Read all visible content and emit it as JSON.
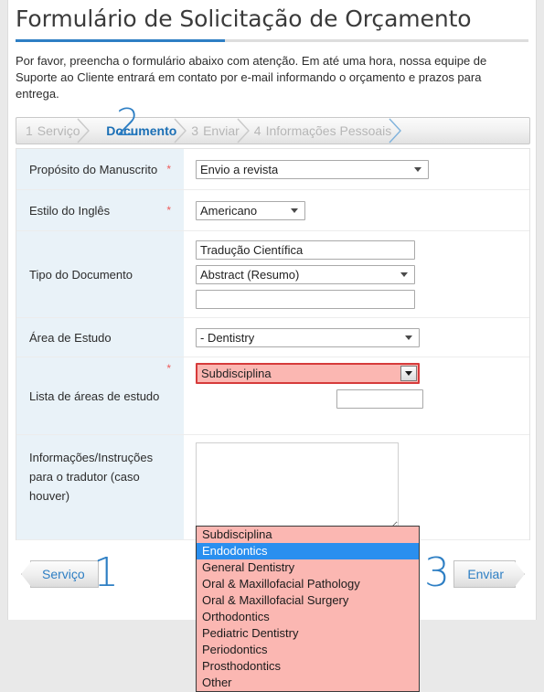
{
  "header": {
    "title": "Formulário de Solicitação de Orçamento",
    "intro": "Por favor, preencha o formulário abaixo com atenção. Em até uma hora, nossa equipe de Suporte ao Cliente entrará em contato por e-mail informando o orçamento e prazos para entrega."
  },
  "accent_color": "#2e7fc4",
  "steps": [
    {
      "num": "1",
      "label": "Serviço",
      "active": false
    },
    {
      "num": "2",
      "label": "Documento",
      "active": true
    },
    {
      "num": "3",
      "label": "Enviar",
      "active": false
    },
    {
      "num": "4",
      "label": "Informações Pessoais",
      "active": false
    }
  ],
  "big_step_number": "2",
  "form": {
    "rows": [
      {
        "label": "Propósito do Manuscrito",
        "required": "*",
        "control": {
          "type": "select",
          "value": "Envio a revista"
        }
      },
      {
        "label": "Estilo do Inglês",
        "required": "*",
        "control": {
          "type": "select",
          "value": "Americano"
        }
      },
      {
        "label": "Tipo do Documento",
        "required": "",
        "controls": [
          {
            "type": "text",
            "value": "Tradução Científica",
            "placeholder": ""
          },
          {
            "type": "select",
            "value": "Abstract (Resumo)"
          },
          {
            "type": "text",
            "value": "",
            "placeholder": ""
          }
        ]
      },
      {
        "label": "Área de Estudo",
        "required": "",
        "control": {
          "type": "select",
          "value": "- Dentistry"
        }
      },
      {
        "label": "Lista de áreas de estudo",
        "required": "*",
        "control": {
          "type": "select",
          "value": "Subdisciplina",
          "state": "invalid-open"
        },
        "extra_text_value": ""
      },
      {
        "label": "Informações/Instruções para o tradutor (caso houver)",
        "required": "",
        "control": {
          "type": "textarea",
          "value": "",
          "placeholder": ""
        }
      }
    ]
  },
  "dropdown": {
    "selected_value": "Subdisciplina",
    "highlighted": "Endodontics",
    "options": [
      "Subdisciplina",
      "Endodontics",
      "General Dentistry",
      "Oral & Maxillofacial Pathology",
      "Oral & Maxillofacial Surgery",
      "Orthodontics",
      "Pediatric Dentistry",
      "Periodontics",
      "Prosthodontics",
      "Other"
    ],
    "background_color": "#fbb7b2",
    "highlight_color": "#2a8fef",
    "border_color": "#d63b3b"
  },
  "footer": {
    "prev": {
      "num": "1",
      "label": "Serviço"
    },
    "next": {
      "num": "3",
      "label": "Enviar"
    }
  }
}
